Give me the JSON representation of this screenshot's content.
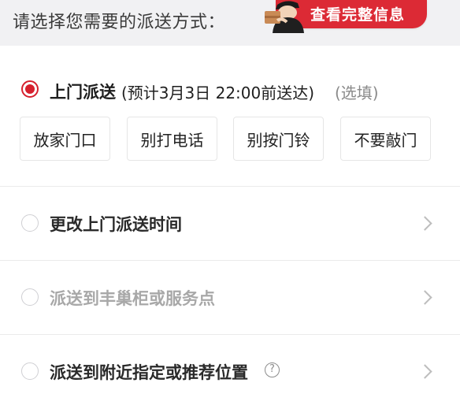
{
  "header": {
    "title": "请选择您需要的派送方式：",
    "view_info_button": "查看完整信息",
    "courier_icon": "courier-mascot-icon"
  },
  "door_delivery": {
    "label": "上门派送",
    "detail": "(预计3月3日 22:00前送达)",
    "optional": "(选填)",
    "selected": true,
    "chips": [
      "放家门口",
      "别打电话",
      "别按门铃",
      "不要敲门"
    ]
  },
  "options": [
    {
      "label": "更改上门派送时间",
      "enabled": true
    },
    {
      "label": "派送到丰巢柜或服务点",
      "enabled": false
    },
    {
      "label": "派送到附近指定或推荐位置",
      "enabled": true,
      "help": "?"
    }
  ],
  "colors": {
    "accent": "#d6202d",
    "header_bg": "#f1f1f3",
    "pill": "#dc2a35"
  }
}
